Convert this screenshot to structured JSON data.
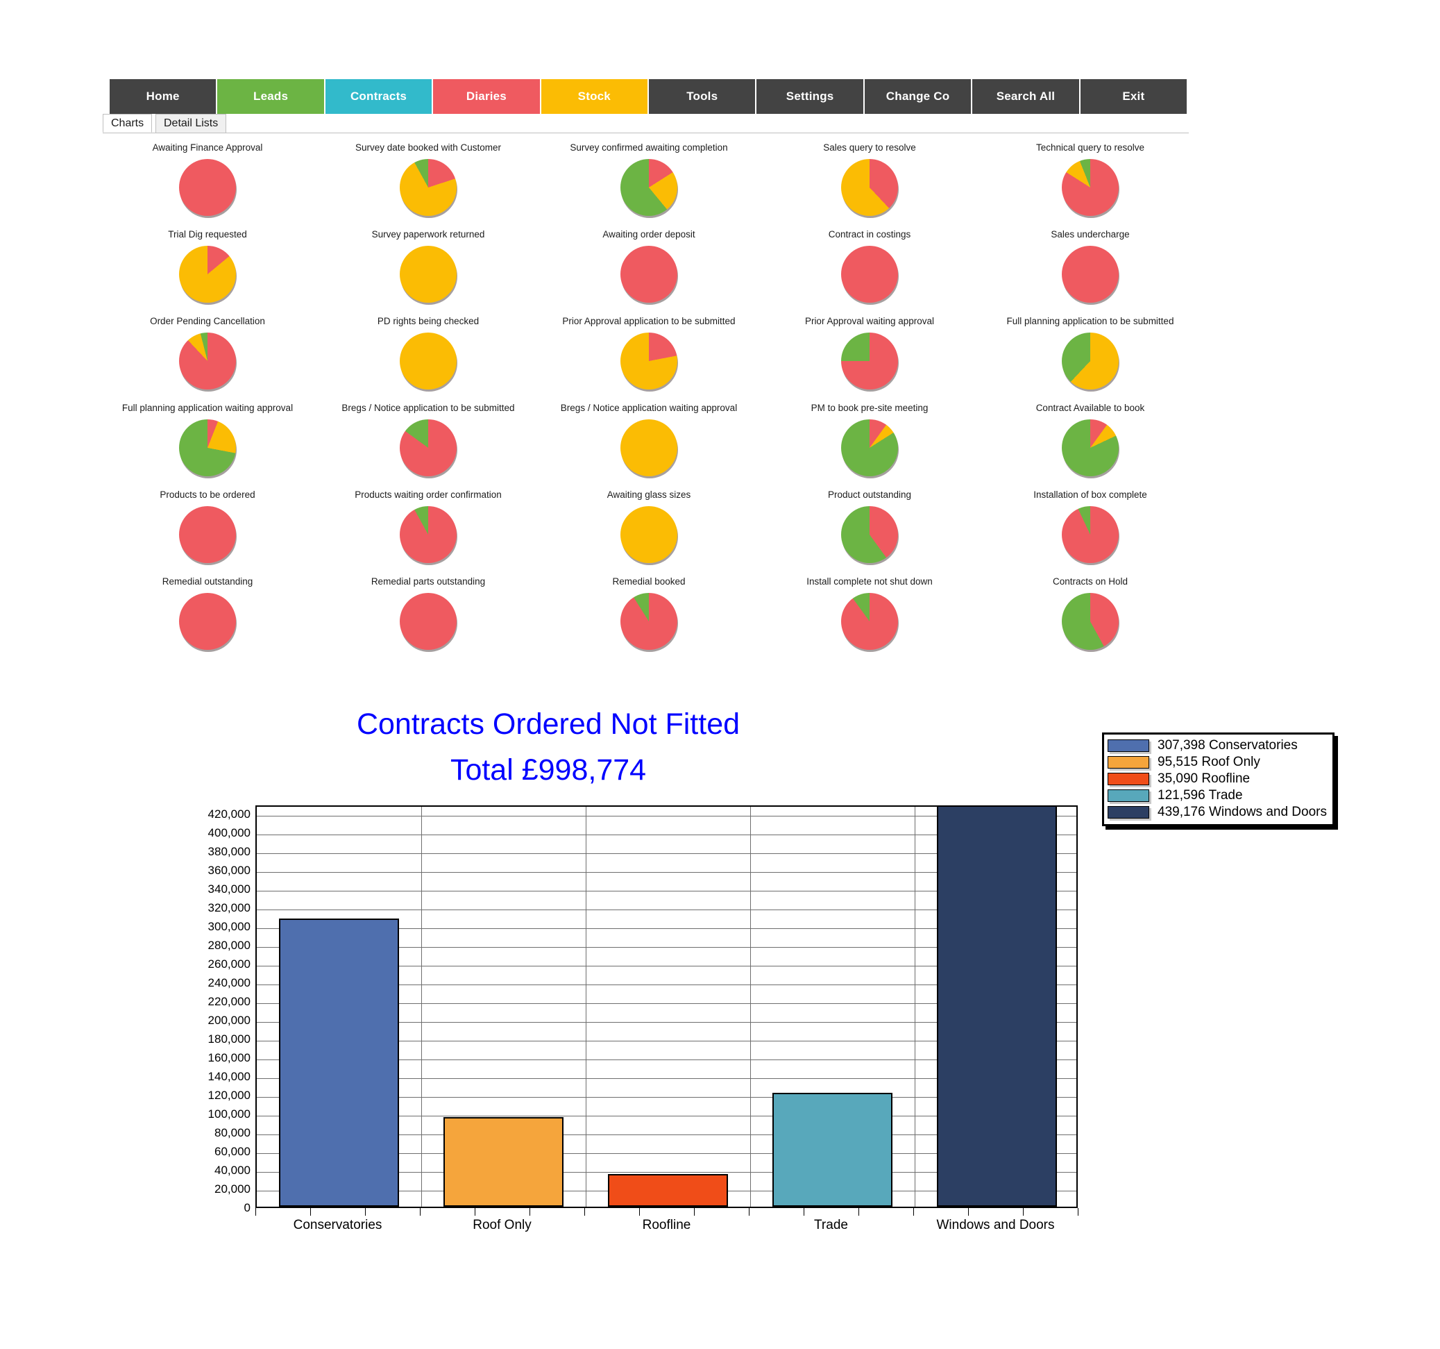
{
  "nav": {
    "items": [
      {
        "label": "Home",
        "bg": "#434343",
        "fg": "#ffffff"
      },
      {
        "label": "Leads",
        "bg": "#6cb444",
        "fg": "#ffffff"
      },
      {
        "label": "Contracts",
        "bg": "#32bacb",
        "fg": "#ffffff"
      },
      {
        "label": "Diaries",
        "bg": "#ef5a60",
        "fg": "#ffffff"
      },
      {
        "label": "Stock",
        "bg": "#fbbc04",
        "fg": "#ffffff"
      },
      {
        "label": "Tools",
        "bg": "#434343",
        "fg": "#ffffff"
      },
      {
        "label": "Settings",
        "bg": "#434343",
        "fg": "#ffffff"
      },
      {
        "label": "Change Co",
        "bg": "#434343",
        "fg": "#ffffff"
      },
      {
        "label": "Search All",
        "bg": "#434343",
        "fg": "#ffffff"
      },
      {
        "label": "Exit",
        "bg": "#434343",
        "fg": "#ffffff"
      }
    ]
  },
  "tabs": {
    "active": "Charts",
    "inactive": "Detail Lists"
  },
  "pie_colors": {
    "red": "#ef5a60",
    "amber": "#fbbc04",
    "green": "#6cb444"
  },
  "pies": [
    {
      "label": "Awaiting Finance Approval",
      "red": 100,
      "amber": 0,
      "green": 0
    },
    {
      "label": "Survey date booked with Customer",
      "red": 20,
      "amber": 72,
      "green": 8
    },
    {
      "label": "Survey confirmed awaiting completion",
      "red": 16,
      "amber": 23,
      "green": 61
    },
    {
      "label": "Sales query to resolve",
      "red": 38,
      "amber": 62,
      "green": 0
    },
    {
      "label": "Technical query to resolve",
      "red": 84,
      "amber": 10,
      "green": 6
    },
    {
      "label": "Trial Dig requested",
      "red": 14,
      "amber": 86,
      "green": 0
    },
    {
      "label": "Survey paperwork returned",
      "red": 0,
      "amber": 100,
      "green": 0
    },
    {
      "label": "Awaiting order deposit",
      "red": 100,
      "amber": 0,
      "green": 0
    },
    {
      "label": "Contract in costings",
      "red": 100,
      "amber": 0,
      "green": 0
    },
    {
      "label": "Sales undercharge",
      "red": 100,
      "amber": 0,
      "green": 0
    },
    {
      "label": "Order Pending Cancellation",
      "red": 88,
      "amber": 8,
      "green": 4
    },
    {
      "label": "PD rights being checked",
      "red": 0,
      "amber": 100,
      "green": 0
    },
    {
      "label": "Prior Approval application to be submitted",
      "red": 22,
      "amber": 78,
      "green": 0
    },
    {
      "label": "Prior Approval waiting approval",
      "red": 75,
      "amber": 0,
      "green": 25
    },
    {
      "label": "Full planning application to be submitted",
      "red": 0,
      "amber": 62,
      "green": 38
    },
    {
      "label": "Full planning application waiting approval",
      "red": 6,
      "amber": 22,
      "green": 72
    },
    {
      "label": "Bregs / Notice application to be submitted",
      "red": 85,
      "amber": 0,
      "green": 15
    },
    {
      "label": "Bregs / Notice application waiting approval",
      "red": 0,
      "amber": 100,
      "green": 0
    },
    {
      "label": "PM to book pre-site meeting",
      "red": 10,
      "amber": 6,
      "green": 84
    },
    {
      "label": "Contract Available to book",
      "red": 10,
      "amber": 8,
      "green": 82
    },
    {
      "label": "Products to be ordered",
      "red": 100,
      "amber": 0,
      "green": 0
    },
    {
      "label": "Products waiting order confirmation",
      "red": 92,
      "amber": 0,
      "green": 8
    },
    {
      "label": "Awaiting glass sizes",
      "red": 0,
      "amber": 100,
      "green": 0
    },
    {
      "label": "Product outstanding",
      "red": 40,
      "amber": 0,
      "green": 60
    },
    {
      "label": "Installation of box complete",
      "red": 93,
      "amber": 0,
      "green": 7
    },
    {
      "label": "Remedial outstanding",
      "red": 100,
      "amber": 0,
      "green": 0
    },
    {
      "label": "Remedial parts outstanding",
      "red": 100,
      "amber": 0,
      "green": 0
    },
    {
      "label": "Remedial booked",
      "red": 91,
      "amber": 0,
      "green": 9
    },
    {
      "label": "Install complete not shut down",
      "red": 90,
      "amber": 0,
      "green": 10
    },
    {
      "label": "Contracts on Hold",
      "red": 42,
      "amber": 0,
      "green": 58
    }
  ],
  "chart_data": {
    "type": "bar",
    "title": "Contracts Ordered Not Fitted",
    "subtitle": "Total £998,774",
    "title_color": "#0000ff",
    "xlabel": "",
    "ylabel": "",
    "ylim": [
      0,
      430000
    ],
    "ytick_step": 20000,
    "grid": true,
    "legend_position": "top-right",
    "categories": [
      "Conservatories",
      "Roof Only",
      "Roofline",
      "Trade",
      "Windows and Doors"
    ],
    "values": [
      307398,
      95515,
      35090,
      121596,
      439176
    ],
    "value_labels": [
      "307,398",
      "95,515",
      "35,090",
      "121,596",
      "439,176"
    ],
    "colors": [
      "#4f6fae",
      "#f5a53c",
      "#f04d18",
      "#58a8bb",
      "#2c3f63"
    ],
    "ytick_labels": [
      "0",
      "20,000",
      "40,000",
      "60,000",
      "80,000",
      "100,000",
      "120,000",
      "140,000",
      "160,000",
      "180,000",
      "200,000",
      "220,000",
      "240,000",
      "260,000",
      "280,000",
      "300,000",
      "320,000",
      "340,000",
      "360,000",
      "380,000",
      "400,000",
      "420,000"
    ],
    "legend": [
      {
        "text": "307,398 Conservatories",
        "color": "#4f6fae"
      },
      {
        "text": "95,515 Roof Only",
        "color": "#f5a53c"
      },
      {
        "text": "35,090 Roofline",
        "color": "#f04d18"
      },
      {
        "text": "121,596 Trade",
        "color": "#58a8bb"
      },
      {
        "text": "439,176 Windows and Doors",
        "color": "#2c3f63"
      }
    ]
  }
}
